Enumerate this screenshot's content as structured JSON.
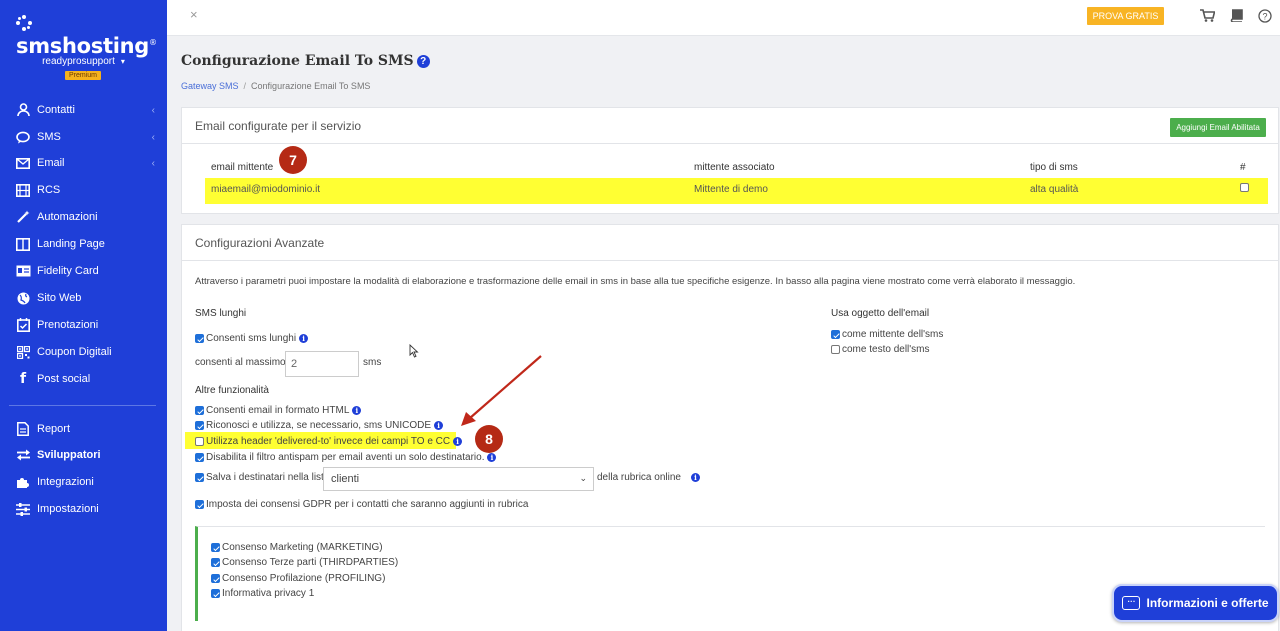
{
  "brand": {
    "name": "smshosting",
    "registered": "®"
  },
  "user": {
    "name": "readyprosupport",
    "caret": "▾",
    "plan": "Premium"
  },
  "sidebar": {
    "items": [
      {
        "label": "Contatti",
        "icon": "user-icon",
        "glyph": "👤",
        "chevron": "‹"
      },
      {
        "label": "SMS",
        "icon": "chat-bubble-icon",
        "glyph": "💬",
        "chevron": "‹"
      },
      {
        "label": "Email",
        "icon": "envelope-icon",
        "glyph": "✉",
        "chevron": "‹"
      },
      {
        "label": "RCS",
        "icon": "film-icon",
        "glyph": "▦",
        "chevron": ""
      },
      {
        "label": "Automazioni",
        "icon": "magic-wand-icon",
        "glyph": "✦",
        "chevron": ""
      },
      {
        "label": "Landing Page",
        "icon": "columns-icon",
        "glyph": "◫",
        "chevron": ""
      },
      {
        "label": "Fidelity Card",
        "icon": "id-card-icon",
        "glyph": "▤",
        "chevron": ""
      },
      {
        "label": "Sito Web",
        "icon": "globe-icon",
        "glyph": "●",
        "chevron": ""
      },
      {
        "label": "Prenotazioni",
        "icon": "calendar-check-icon",
        "glyph": "☑",
        "chevron": ""
      },
      {
        "label": "Coupon Digitali",
        "icon": "qrcode-icon",
        "glyph": "▩",
        "chevron": ""
      },
      {
        "label": "Post social",
        "icon": "facebook-icon",
        "glyph": "f",
        "chevron": ""
      }
    ],
    "bottom_items": [
      {
        "label": "Report",
        "icon": "document-icon",
        "glyph": "▤"
      },
      {
        "label": "Sviluppatori",
        "icon": "exchange-arrows-icon",
        "glyph": "⇄"
      },
      {
        "label": "Integrazioni",
        "icon": "puzzle-icon",
        "glyph": "✚"
      },
      {
        "label": "Impostazioni",
        "icon": "sliders-icon",
        "glyph": "☰"
      }
    ]
  },
  "topbar": {
    "close": "×",
    "cta": "PROVA GRATIS",
    "cart": "🛒",
    "book": "📘",
    "help": "?"
  },
  "page": {
    "title": "Configurazione Email To SMS",
    "help": "?",
    "breadcrumb": {
      "parent": "Gateway SMS",
      "sep": "/",
      "current": "Configurazione Email To SMS"
    }
  },
  "emails_panel": {
    "title": "Email configurate per il servizio",
    "add_button": "Aggiungi Email Abilitata",
    "columns": [
      "email mittente",
      "mittente associato",
      "tipo di sms",
      "#"
    ],
    "rows": [
      {
        "email": "miaemail@miodominio.it",
        "sender": "Mittente di demo",
        "type": "alta qualità",
        "checked": false
      }
    ]
  },
  "advanced_panel": {
    "title": "Configurazioni Avanzate",
    "intro": "Attraverso i parametri puoi impostare la modalità di elaborazione e trasformazione delle email in sms in base alla tue specifiche esigenze. In basso alla pagina viene mostrato come verrà elaborato il messaggio.",
    "long_sms": {
      "heading": "SMS lunghi",
      "allow_label": "Consenti sms lunghi",
      "allow_checked": true,
      "max_label": "consenti al massimo",
      "max_value": "2",
      "max_unit": "sms"
    },
    "subject": {
      "heading": "Usa oggetto dell'email",
      "as_sender": "come mittente dell'sms",
      "as_sender_checked": true,
      "as_text": "come testo dell'sms",
      "as_text_checked": false
    },
    "other": {
      "heading": "Altre funzionalità",
      "html": "Consenti email in formato HTML",
      "unicode": "Riconosci e utilizza, se necessario, sms UNICODE",
      "delivered_to": "Utilizza header 'delivered-to' invece dei campi TO e CC",
      "antispam": "Disabilita il filtro antispam per email aventi un solo destinatario.",
      "save_list": "Salva i destinatari nella lista",
      "list_value": "clienti",
      "list_suffix": "della rubrica online",
      "gdpr": "Imposta dei consensi GDPR per i contatti che saranno aggiunti in rubrica"
    },
    "consents": [
      "Consenso Marketing (MARKETING)",
      "Consenso Terze parti (THIRDPARTIES)",
      "Consenso Profilazione (PROFILING)",
      "Informativa privacy 1"
    ]
  },
  "annotations": {
    "step_a": "7",
    "step_b": "8"
  },
  "chat": {
    "label": "Informazioni e offerte",
    "icon_glyph": "···"
  },
  "colors": {
    "sidebar": "#1f3fd8",
    "highlight": "#ffff33",
    "annotation": "#b52a15",
    "success": "#4cae4c",
    "cta": "#f8b424"
  }
}
